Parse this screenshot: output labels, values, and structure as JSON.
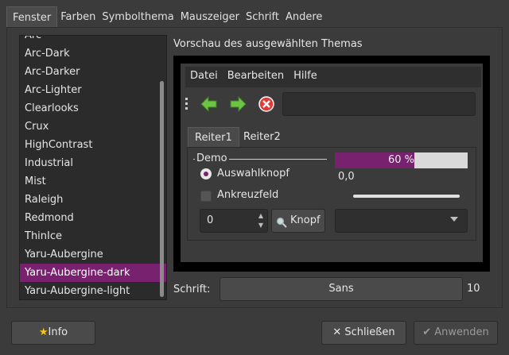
{
  "tabs": [
    "Fenster",
    "Farben",
    "Symbolthema",
    "Mauszeiger",
    "Schrift",
    "Andere"
  ],
  "theme_list": {
    "items": [
      "Arc",
      "Arc-Dark",
      "Arc-Darker",
      "Arc-Lighter",
      "Clearlooks",
      "Crux",
      "HighContrast",
      "Industrial",
      "Mist",
      "Raleigh",
      "Redmond",
      "ThinIce",
      "Yaru-Aubergine",
      "Yaru-Aubergine-dark",
      "Yaru-Aubergine-light"
    ],
    "selected": "Yaru-Aubergine-dark"
  },
  "preview": {
    "title": "Vorschau des ausgewählten Themas",
    "menu": [
      "Datei",
      "Bearbeiten",
      "Hilfe"
    ],
    "subtabs": [
      "Reiter1",
      "Reiter2"
    ],
    "demo_legend": "Demo",
    "radio_label": "Auswahlknopf",
    "check_label": "Ankreuzfeld",
    "spin_value": "0",
    "button_label": "Knopf",
    "progress": {
      "value": 0.6,
      "label": "60 %"
    },
    "scale_value": "0,0",
    "accent_color": "#77216f"
  },
  "font": {
    "label": "Schrift:",
    "name": "Sans",
    "size": "10"
  },
  "footer": {
    "info": "Info",
    "close": "Schließen",
    "apply": "Anwenden"
  }
}
